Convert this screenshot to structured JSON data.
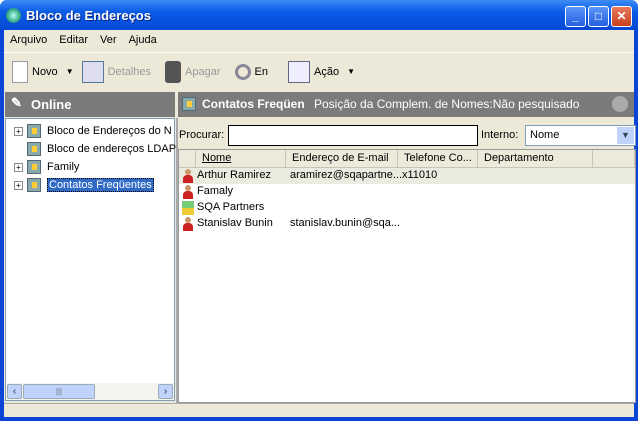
{
  "window": {
    "title": "Bloco de Endereços"
  },
  "menu": [
    "Arquivo",
    "Editar",
    "Ver",
    "Ajuda"
  ],
  "toolbar": {
    "novo": "Novo",
    "detalhes": "Detalhes",
    "apagar": "Apagar",
    "find": "En",
    "acao": "Ação"
  },
  "left_pane": {
    "header": "Online",
    "tree": [
      {
        "label": "Bloco de Endereços do N",
        "expandable": true
      },
      {
        "label": "Bloco de endereços LDAP",
        "expandable": false
      },
      {
        "label": "Family",
        "expandable": true
      },
      {
        "label": "Contatos Freqüentes",
        "expandable": true,
        "selected": true
      }
    ]
  },
  "right_pane": {
    "header_title": "Contatos Freqüen",
    "header_status": "Posição da Complem. de Nomes:Não pesquisado",
    "search_label": "Procurar:",
    "search_value": "",
    "interno_label": "Interno:",
    "interno_value": "Nome",
    "columns": [
      "Nome",
      "Endereço de E-mail",
      "Telefone Co...",
      "Departamento"
    ],
    "rows": [
      {
        "icon": "person-icon",
        "name": "Arthur Ramirez",
        "email": "aramirez@sqapartne...",
        "phone": "x11010",
        "dept": ""
      },
      {
        "icon": "group-icon",
        "name": "Famaly",
        "email": "",
        "phone": "",
        "dept": ""
      },
      {
        "icon": "organization-icon",
        "name": "SQA Partners",
        "email": "",
        "phone": "",
        "dept": ""
      },
      {
        "icon": "person-icon",
        "name": "Stanislav Bunin",
        "email": "stanislav.bunin@sqa...",
        "phone": "",
        "dept": ""
      }
    ]
  }
}
